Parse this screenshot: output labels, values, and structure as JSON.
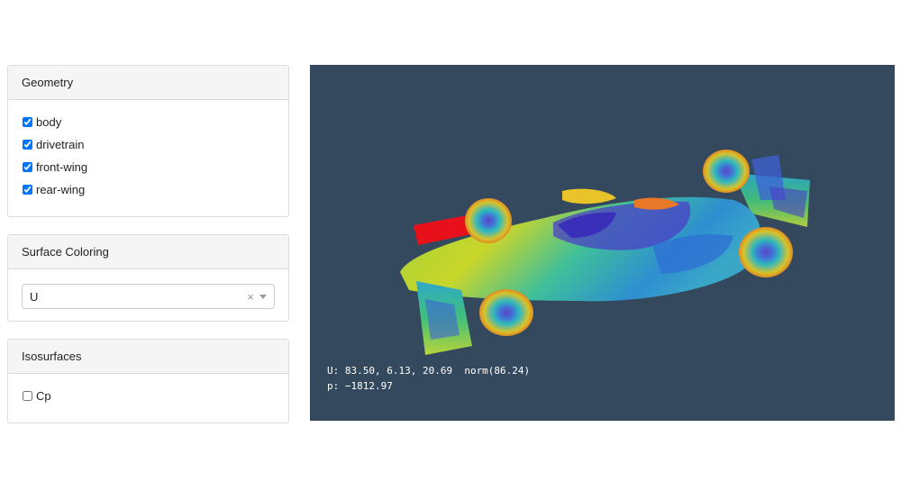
{
  "geometry": {
    "title": "Geometry",
    "items": [
      {
        "label": "body",
        "checked": true
      },
      {
        "label": "drivetrain",
        "checked": true
      },
      {
        "label": "front-wing",
        "checked": true
      },
      {
        "label": "rear-wing",
        "checked": true
      }
    ]
  },
  "surface_coloring": {
    "title": "Surface Coloring",
    "selected": "U",
    "clear_symbol": "×"
  },
  "isosurfaces": {
    "title": "Isosurfaces",
    "items": [
      {
        "label": "Cp",
        "checked": false
      }
    ]
  },
  "viewport": {
    "background": "#34495e",
    "probe_velocity": "U: 83.50, 6.13, 20.69  norm(86.24)",
    "probe_pressure": "p: −1812.97"
  }
}
